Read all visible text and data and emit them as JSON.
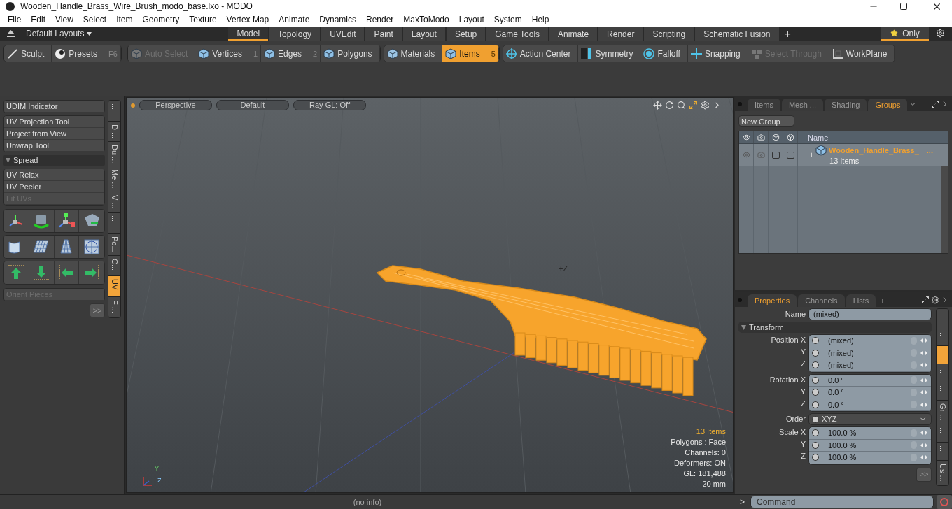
{
  "window": {
    "title": "Wooden_Handle_Brass_Wire_Brush_modo_base.lxo - MODO"
  },
  "menu": [
    "File",
    "Edit",
    "View",
    "Select",
    "Item",
    "Geometry",
    "Texture",
    "Vertex Map",
    "Animate",
    "Dynamics",
    "Render",
    "MaxToModo",
    "Layout",
    "System",
    "Help"
  ],
  "layout_bar": {
    "preset": "Default Layouts",
    "tabs": [
      {
        "label": "Model",
        "selected": true
      },
      {
        "label": "Topology",
        "selected": false
      },
      {
        "label": "UVEdit",
        "selected": false
      },
      {
        "label": "Paint",
        "selected": false
      },
      {
        "label": "Layout",
        "selected": false
      },
      {
        "label": "Setup",
        "selected": false
      },
      {
        "label": "Game Tools",
        "selected": false
      },
      {
        "label": "Animate",
        "selected": false
      },
      {
        "label": "Render",
        "selected": false
      },
      {
        "label": "Scripting",
        "selected": false
      },
      {
        "label": "Schematic Fusion",
        "selected": false
      }
    ],
    "add": "+",
    "filter": {
      "label": "Only",
      "on": true
    }
  },
  "toolbar": [
    {
      "items": [
        {
          "label": "Sculpt",
          "disabled": false,
          "selected": false
        },
        {
          "label": "Presets",
          "shortcut": "F6",
          "disabled": false,
          "selected": false
        }
      ]
    },
    {
      "items": [
        {
          "label": "Auto Select",
          "disabled": true,
          "selected": false
        },
        {
          "label": "Vertices",
          "shortcut": "1",
          "disabled": false,
          "selected": false
        },
        {
          "label": "Edges",
          "shortcut": "2",
          "disabled": false,
          "selected": false
        },
        {
          "label": "Polygons",
          "disabled": false,
          "selected": false
        }
      ]
    },
    {
      "items": [
        {
          "label": "Materials",
          "disabled": false,
          "selected": false
        },
        {
          "label": "Items",
          "shortcut": "5",
          "disabled": false,
          "selected": true
        }
      ]
    },
    {
      "items": [
        {
          "label": "Action Center",
          "disabled": false,
          "selected": false
        },
        {
          "label": "Symmetry",
          "disabled": false,
          "selected": false
        },
        {
          "label": "Falloff",
          "disabled": false,
          "selected": false
        },
        {
          "label": "Snapping",
          "disabled": false,
          "selected": false
        },
        {
          "label": "Select Through",
          "disabled": true,
          "selected": false
        },
        {
          "label": "WorkPlane",
          "disabled": false,
          "selected": false
        }
      ]
    }
  ],
  "tool_panel": {
    "sections": [
      {
        "kind": "buttons",
        "buttons": [
          {
            "label": "UDIM Indicator",
            "disabled": false
          }
        ]
      },
      {
        "kind": "buttons",
        "buttons": [
          {
            "label": "UV Projection Tool",
            "disabled": false
          },
          {
            "label": "Project from View",
            "disabled": false
          },
          {
            "label": "Unwrap Tool",
            "disabled": false
          }
        ]
      },
      {
        "kind": "header",
        "label": "Spread",
        "expanded": true
      },
      {
        "kind": "buttons",
        "buttons": [
          {
            "label": "UV Relax",
            "disabled": false
          },
          {
            "label": "UV Peeler",
            "disabled": false
          },
          {
            "label": "Fit UVs",
            "disabled": true
          }
        ]
      },
      {
        "kind": "icons"
      },
      {
        "kind": "buttons",
        "buttons": [
          {
            "label": "Orient Pieces",
            "disabled": true
          }
        ]
      }
    ],
    "more": ">>",
    "side_tabs": [
      {
        "label": "...",
        "selected": false
      },
      {
        "label": "D ...",
        "selected": false
      },
      {
        "label": "Du ...",
        "selected": false
      },
      {
        "label": "Me ...",
        "selected": false
      },
      {
        "label": "V ...",
        "selected": false
      },
      {
        "label": "...",
        "selected": false
      },
      {
        "label": "Po...",
        "selected": false
      },
      {
        "label": "C...",
        "selected": false
      },
      {
        "label": "UV",
        "selected": true
      },
      {
        "label": "F ...",
        "selected": false
      }
    ]
  },
  "viewport": {
    "buttons": [
      "Perspective",
      "Default",
      "Ray GL: Off"
    ],
    "axis_label": "+Z",
    "gizmo": {
      "y": "Y",
      "z": "Z"
    },
    "info": [
      {
        "text": "13 Items",
        "highlight": true
      },
      {
        "text": "Polygons : Face",
        "highlight": false
      },
      {
        "text": "Channels: 0",
        "highlight": false
      },
      {
        "text": "Deformers: ON",
        "highlight": false
      },
      {
        "text": "GL: 181,488",
        "highlight": false
      },
      {
        "text": "20 mm",
        "highlight": false
      }
    ]
  },
  "groups_panel": {
    "tabs": [
      {
        "label": "Items",
        "selected": false
      },
      {
        "label": "Mesh ...",
        "selected": false
      },
      {
        "label": "Shading",
        "selected": false
      },
      {
        "label": "Groups",
        "selected": true
      }
    ],
    "new_group": "New Group",
    "name_column": "Name",
    "rows": [
      {
        "expander": "+",
        "name": "Wooden_Handle_Brass_",
        "more": "...",
        "count": "13 Items"
      }
    ]
  },
  "properties_panel": {
    "tabs": [
      {
        "label": "Properties",
        "selected": true
      },
      {
        "label": "Channels",
        "selected": false
      },
      {
        "label": "Lists",
        "selected": false
      }
    ],
    "add": "+",
    "name": {
      "label": "Name",
      "value": "(mixed)"
    },
    "section": {
      "label": "Transform",
      "expanded": true
    },
    "groups": [
      {
        "kind": "vector",
        "rows": [
          {
            "label": "Position X",
            "value": "(mixed)"
          },
          {
            "label": "Y",
            "value": "(mixed)"
          },
          {
            "label": "Z",
            "value": "(mixed)"
          }
        ]
      },
      {
        "kind": "vector",
        "rows": [
          {
            "label": "Rotation X",
            "value": "0.0 °"
          },
          {
            "label": "Y",
            "value": "0.0 °"
          },
          {
            "label": "Z",
            "value": "0.0 °"
          }
        ]
      },
      {
        "kind": "choice",
        "label": "Order",
        "value": "XYZ"
      },
      {
        "kind": "vector",
        "rows": [
          {
            "label": "Scale X",
            "value": "100.0 %"
          },
          {
            "label": "Y",
            "value": "100.0 %"
          },
          {
            "label": "Z",
            "value": "100.0 %"
          }
        ]
      }
    ],
    "more": ">>",
    "side_tabs": [
      {
        "label": "...",
        "selected": false
      },
      {
        "label": "...",
        "selected": false
      },
      {
        "selected": true
      },
      {
        "label": "...",
        "selected": false
      },
      {
        "label": "...",
        "selected": false
      },
      {
        "label": "Gr ...",
        "selected": false
      },
      {
        "label": "...",
        "selected": false
      },
      {
        "label": "...",
        "selected": false
      },
      {
        "label": "Us ...",
        "selected": false
      }
    ]
  },
  "status": {
    "info": "(no info)",
    "prompt": ">",
    "command_placeholder": "Command"
  }
}
